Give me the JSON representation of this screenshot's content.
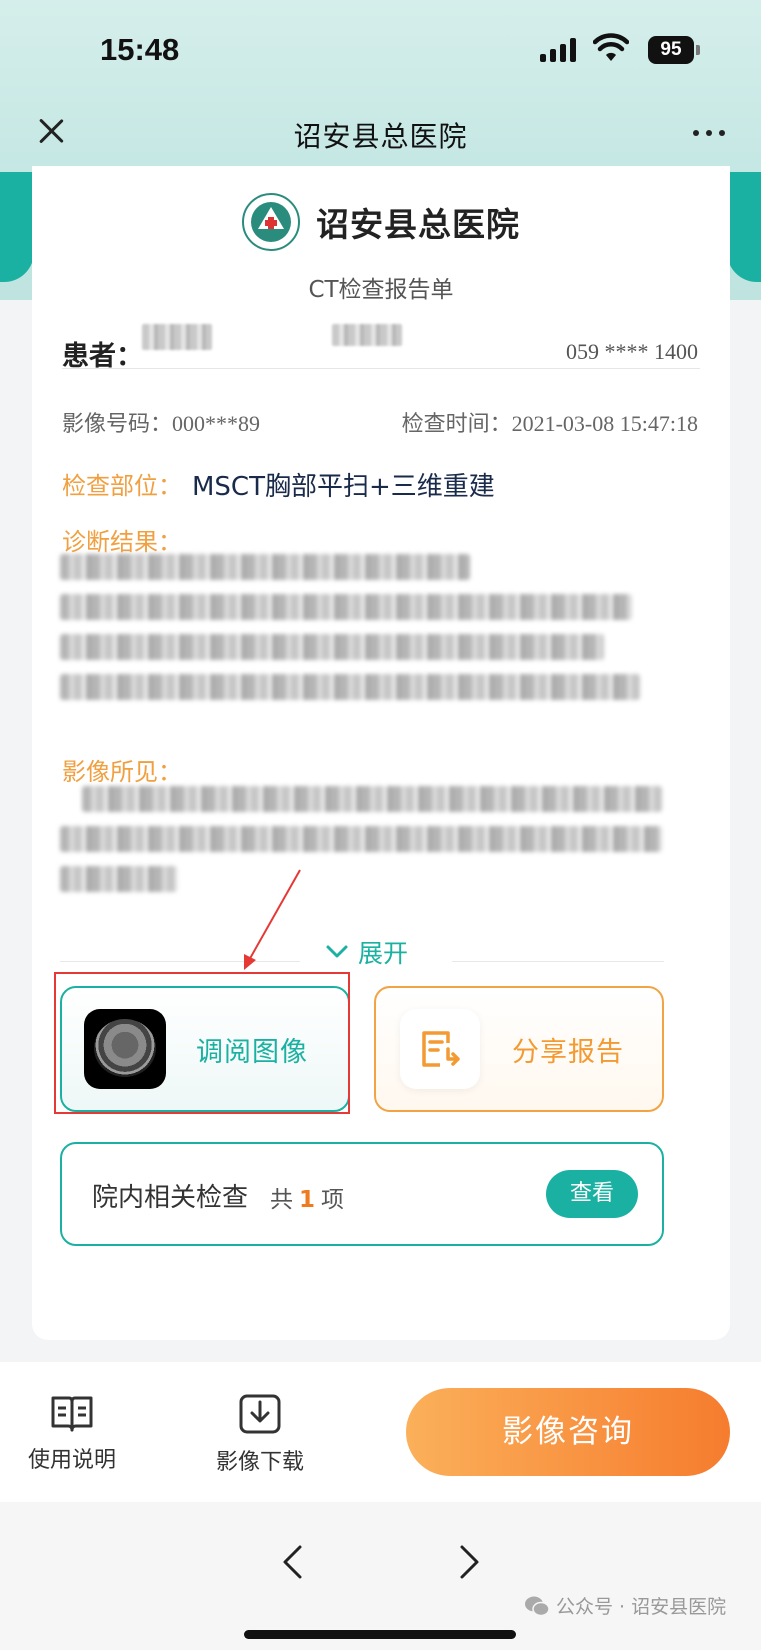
{
  "status_bar": {
    "time": "15:48",
    "battery": "95"
  },
  "nav": {
    "title": "诏安县总医院"
  },
  "report": {
    "hospital_name": "诏安县总医院",
    "report_type": "CT检查报告单",
    "patient_label": "患者：",
    "phone": "059 **** 1400",
    "image_no_label": "影像号码：",
    "image_no_value": "000***89",
    "exam_time_label": "检查时间：",
    "exam_time_value": "2021-03-08 15:47:18",
    "exam_part_label": "检查部位：",
    "exam_part_value": "MSCT胸部平扫+三维重建",
    "diagnosis_label": "诊断结果：",
    "findings_label": "影像所见：",
    "expand_label": "展开"
  },
  "actions": {
    "view_images_label": "调阅图像",
    "share_report_label": "分享报告"
  },
  "related": {
    "label": "院内相关检查",
    "count_prefix": "共",
    "count": "1",
    "count_suffix": "项",
    "button_label": "查看"
  },
  "toolbar": {
    "instructions_label": "使用说明",
    "download_label": "影像下载",
    "consult_label": "影像咨询"
  },
  "footer": {
    "watermark": "公众号 · 诏安县医院"
  },
  "colors": {
    "accent": "#1bb1a2",
    "orange": "#f39a33",
    "highlight": "#e53935"
  }
}
